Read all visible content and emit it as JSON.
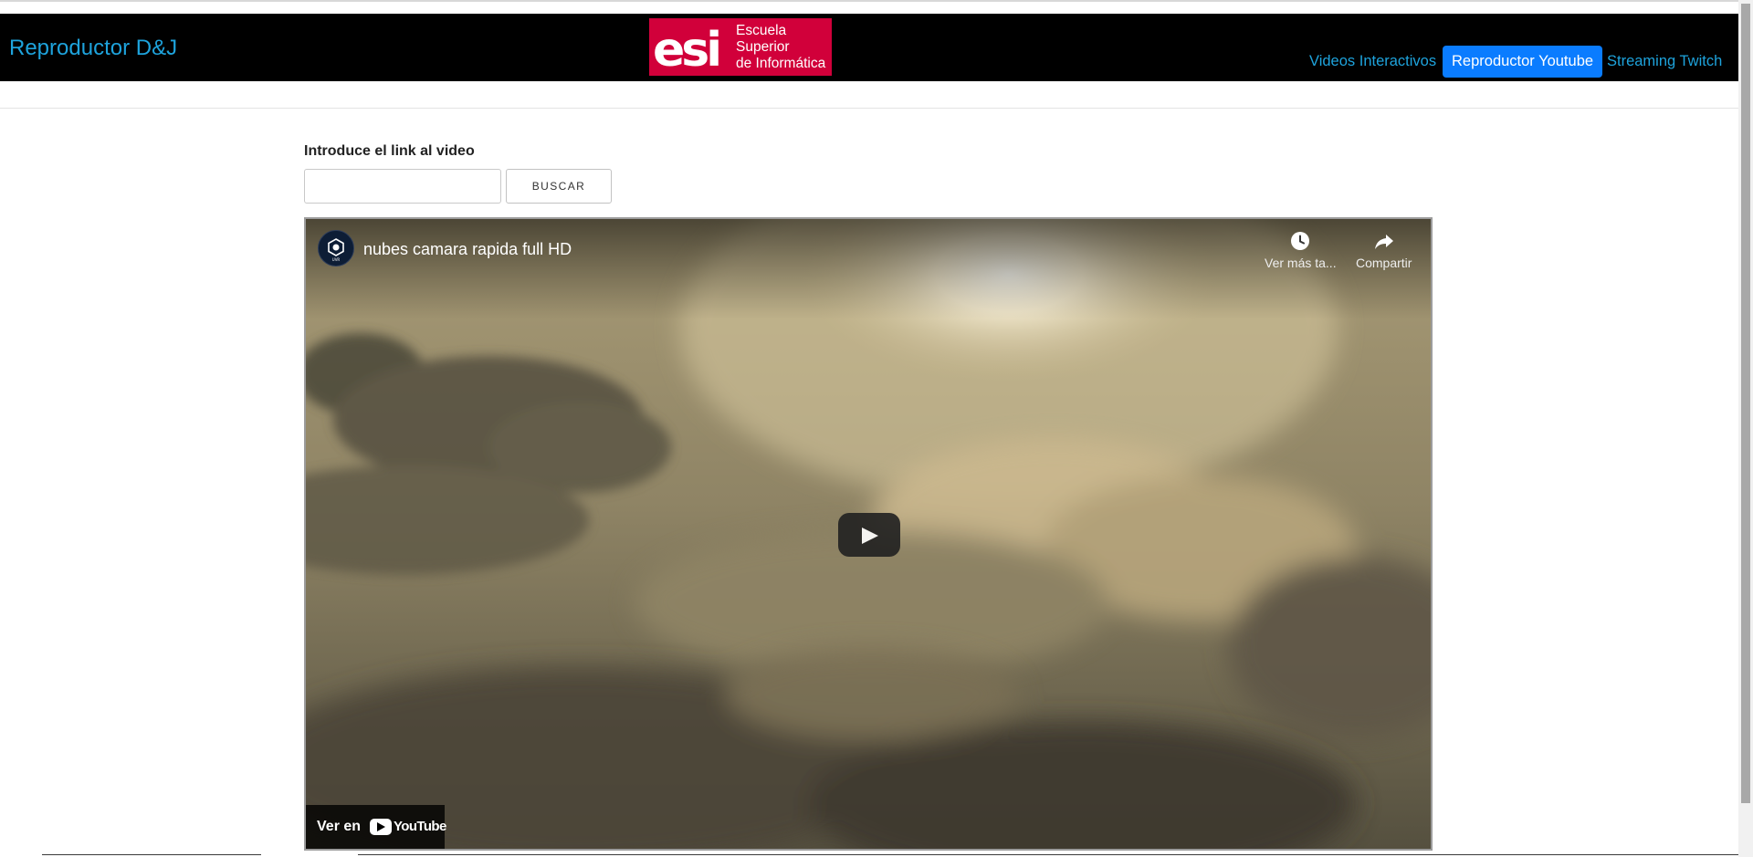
{
  "navbar": {
    "brand": "Reproductor D&J",
    "logo_text_lines": [
      "Escuela",
      "Superior",
      "de Informática"
    ],
    "links": [
      "Videos Interactivos",
      "Reproductor Youtube",
      "Streaming Twitch"
    ],
    "active_link": "Reproductor Youtube"
  },
  "search": {
    "label": "Introduce el link al video",
    "input_value": "",
    "button_label": "BUSCAR"
  },
  "player": {
    "title": "nubes camara rapida full HD",
    "watch_later_label": "Ver más ta...",
    "share_label": "Compartir",
    "watch_on_label": "Ver en",
    "youtube_wordmark": "YouTube"
  },
  "colors": {
    "navbar_bg": "#000000",
    "link": "#1ea3dc",
    "active_link_bg": "#0a7cff",
    "logo_bg": "#d1003a"
  },
  "icons": {
    "watch_later": "clock-icon",
    "share": "share-arrow-icon",
    "play": "play-icon",
    "channel": "channel-avatar"
  }
}
